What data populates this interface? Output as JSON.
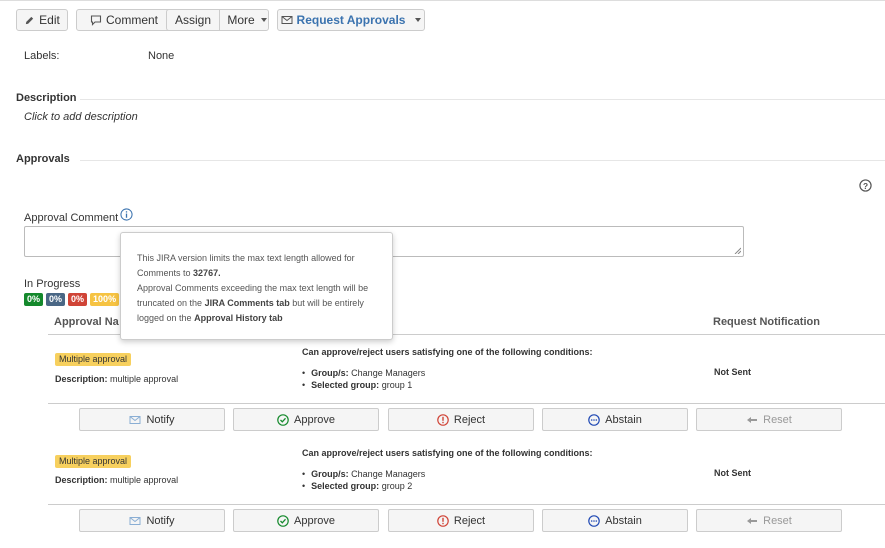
{
  "toolbar": {
    "edit": "Edit",
    "comment": "Comment",
    "assign": "Assign",
    "more": "More",
    "request_approvals": "Request Approvals"
  },
  "labels": {
    "label": "Labels:",
    "value": "None"
  },
  "description": {
    "title": "Description",
    "placeholder": "Click to add description"
  },
  "approvals": {
    "title": "Approvals",
    "comment_label": "Approval Comment",
    "status": "In Progress",
    "badges": [
      {
        "text": "0%",
        "color": "#14892c"
      },
      {
        "text": "0%",
        "color": "#4a6785"
      },
      {
        "text": "0%",
        "color": "#d04437"
      },
      {
        "text": "100%",
        "color": "#f6c342"
      }
    ],
    "tooltip": {
      "line1": "This JIRA version limits the max text length allowed for Comments to",
      "limit": "32767.",
      "line2": "Approval Comments exceeding the max text length will be truncated on the",
      "tab1": "JIRA Comments tab",
      "line3": "but will be entirely logged on the",
      "tab2": "Approval History tab"
    },
    "columns": {
      "name": "Approval Na",
      "notification": "Request Notification"
    },
    "rows": [
      {
        "tag": "Multiple approval",
        "desc_label": "Description:",
        "desc_value": "multiple approval",
        "cond_title": "Can approve/reject users satisfying one of the following conditions:",
        "group_label": "Group/s:",
        "group_value": "Change Managers",
        "selected_label": "Selected group:",
        "selected_value": "group 1",
        "notification": "Not Sent"
      },
      {
        "tag": "Multiple approval",
        "desc_label": "Description:",
        "desc_value": "multiple approval",
        "cond_title": "Can approve/reject users satisfying one of the following conditions:",
        "group_label": "Group/s:",
        "group_value": "Change Managers",
        "selected_label": "Selected group:",
        "selected_value": "group 2",
        "notification": "Not Sent"
      }
    ],
    "actions": {
      "notify": "Notify",
      "approve": "Approve",
      "reject": "Reject",
      "abstain": "Abstain",
      "reset": "Reset"
    }
  }
}
